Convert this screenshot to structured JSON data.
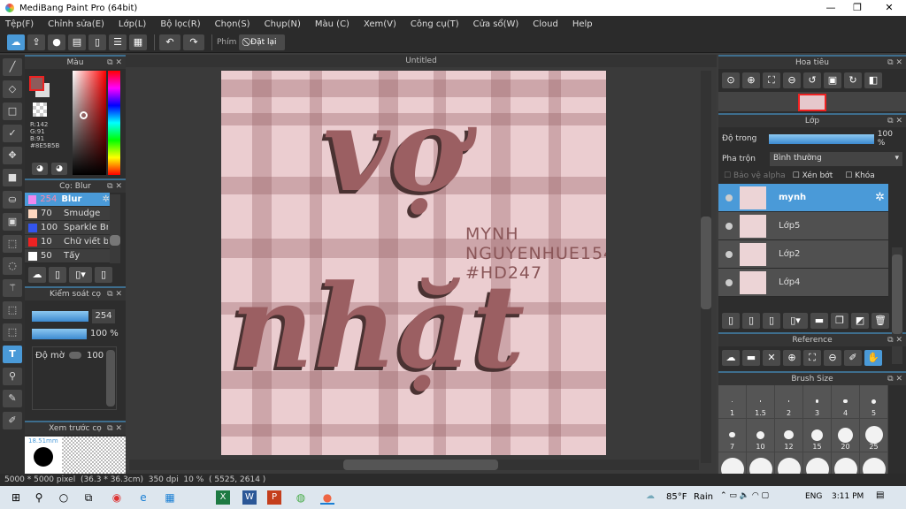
{
  "app": {
    "title": "MediBang Paint Pro (64bit)"
  },
  "menu": [
    "Tệp(F)",
    "Chỉnh sửa(E)",
    "Lớp(L)",
    "Bộ lọc(R)",
    "Chọn(S)",
    "Chụp(N)",
    "Màu (C)",
    "Xem(V)",
    "Công cụ(T)",
    "Cửa sổ(W)",
    "Cloud",
    "Help"
  ],
  "toolbar": {
    "shortcut_label": "Phím",
    "reset_label": "Đặt lại"
  },
  "color_panel": {
    "title": "Màu",
    "r": "R:142",
    "g": "G:91",
    "b": "B:91",
    "hex": "#8E5B5B",
    "primary_color": "#8e5b5b",
    "secondary_color": "#dddddd"
  },
  "brush_panel": {
    "title": "Cọ: Blur",
    "items": [
      {
        "size": "254",
        "name": "Blur",
        "color": "#ee88ee"
      },
      {
        "size": "70",
        "name": "Smudge",
        "color": "#ffd8c0"
      },
      {
        "size": "100",
        "name": "Sparkle Bru",
        "color": "#3355ee"
      },
      {
        "size": "10",
        "name": "Chữ viết bả",
        "color": "#ee2222"
      },
      {
        "size": "50",
        "name": "Tẩy",
        "color": "#ffffff"
      }
    ]
  },
  "brush_control": {
    "title": "Kiểm soát cọ",
    "size": "254",
    "opacity": "100 %",
    "density_label": "Độ mờ",
    "density": "100"
  },
  "brush_preview": {
    "title": "Xem trước cọ",
    "size": "18.51mm"
  },
  "canvas": {
    "tab": "Untitled",
    "line1": "vợ",
    "line2": "nhặt",
    "tag1": "MYNH",
    "tag2": "NGUYENHUE154",
    "tag3": "#HD247"
  },
  "navigator": {
    "title": "Hoa tiêu"
  },
  "layers": {
    "title": "Lớp",
    "opacity_label": "Độ trong",
    "opacity": "100 %",
    "opacity_value": 100,
    "blend_label": "Pha trộn",
    "blend": "Bình thường",
    "protect_alpha": "Bảo vệ alpha",
    "clip": "Xén bớt",
    "lock": "Khóa",
    "items": [
      {
        "name": "mynh",
        "selected": true
      },
      {
        "name": "Lớp5"
      },
      {
        "name": "Lớp2"
      },
      {
        "name": "Lớp4"
      }
    ]
  },
  "reference": {
    "title": "Reference"
  },
  "brush_size": {
    "title": "Brush Size",
    "sizes": [
      "1",
      "1.5",
      "2",
      "3",
      "4",
      "5",
      "7",
      "10",
      "12",
      "15",
      "20",
      "25"
    ]
  },
  "status": {
    "dimensions": "5000 * 5000 pixel",
    "physical": "(36.3 * 36.3cm)",
    "dpi": "350 dpi",
    "zoom": "10 %",
    "coords": "( 5525, 2614 )"
  },
  "taskbar": {
    "weather": "85°F",
    "condition": "Rain",
    "lang": "ENG",
    "time": "3:11 PM"
  }
}
